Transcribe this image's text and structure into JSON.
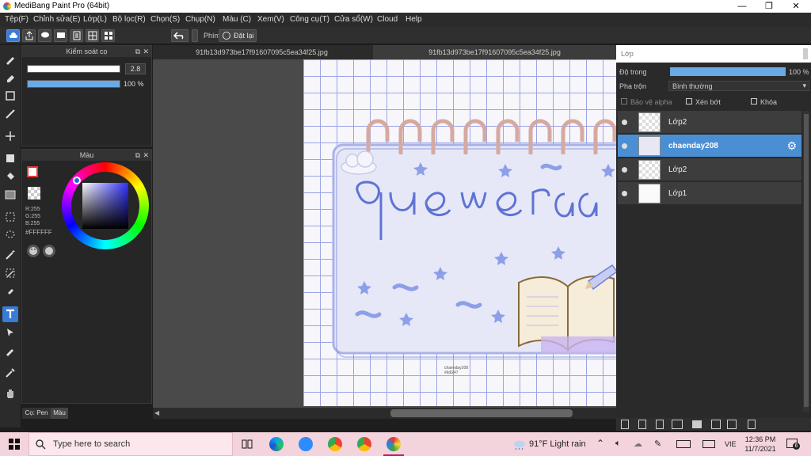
{
  "window": {
    "title": "MediBang Paint Pro (64bit)",
    "min": "—",
    "max": "❐",
    "close": "✕"
  },
  "menu": [
    "Tệp(F)",
    "Chỉnh sửa(E)",
    "Lớp(L)",
    "Bộ lọc(R)",
    "Chọn(S)",
    "Chụp(N)",
    "Màu (C)",
    "Xem(V)",
    "Công cụ(T)",
    "Cửa sổ(W)",
    "Cloud",
    "Help"
  ],
  "toolbar": {
    "key_label": "Phím",
    "reset_label": "Đặt lại"
  },
  "brush_panel": {
    "title": "Kiểm soát cọ",
    "size_value": "2.8",
    "opacity_value": "100 %"
  },
  "color_panel": {
    "title": "Màu",
    "r": "R:255",
    "g": "G:255",
    "b": "B:255",
    "hex": "#FFFFFF",
    "accent": "#ff0000"
  },
  "bottom_tabs": {
    "brush_tab": "Cọ: Pen",
    "color_tab": "Màu"
  },
  "canvas": {
    "tab1": "91fb13d973be17f91607095c5ea34f25.jpg",
    "tab2": "91fb13d973be17f91607095c5ea34f25.jpg",
    "signature_line1": "chaenday208",
    "signature_line2": "#kdi247"
  },
  "layer_panel": {
    "title": "Lớp",
    "opacity_label": "Độ trong",
    "opacity_value": "100 %",
    "blend_label": "Pha trộn",
    "blend_value": "Bình thường",
    "protect_alpha": "Bảo vệ alpha",
    "clip": "Xén bớt",
    "lock": "Khóa",
    "layers": [
      {
        "name": "Lớp2"
      },
      {
        "name": "chaenday208"
      },
      {
        "name": "Lớp2"
      },
      {
        "name": "Lớp1"
      }
    ]
  },
  "taskbar": {
    "search_placeholder": "Type here to search",
    "weather": "91°F  Light rain",
    "lang": "VIE",
    "time": "12:36 PM",
    "date": "11/7/2021",
    "notif_count": "6"
  },
  "colors": {
    "selected_layer": "#4a8fd4",
    "taskbar_bg": "#f3d3dc",
    "grid": "#9da4e6"
  }
}
